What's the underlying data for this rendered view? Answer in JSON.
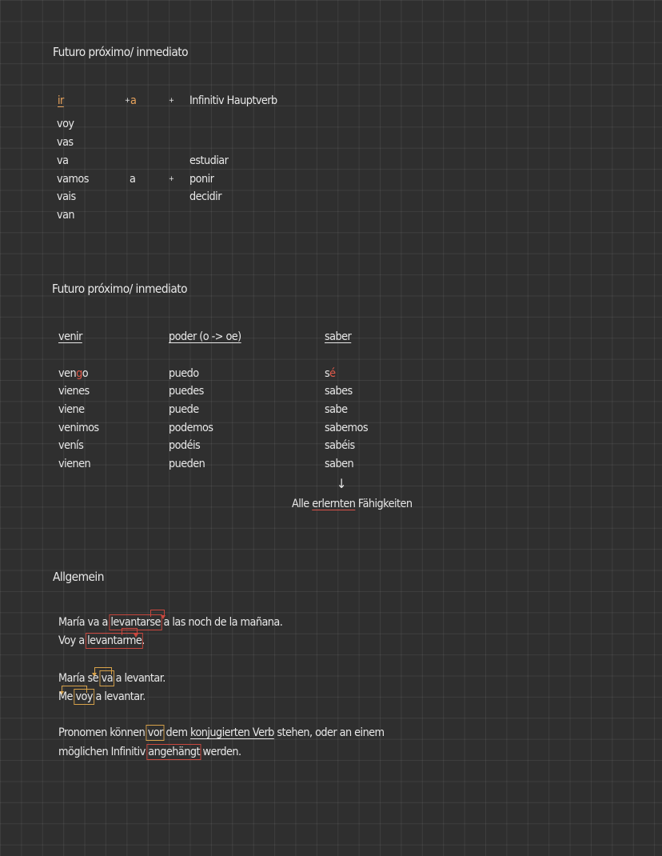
{
  "section1": {
    "title": "Futuro próximo/ inmediato",
    "header_ir": "ir",
    "header_plus1": "+",
    "header_a": "a",
    "header_plus2": "+",
    "header_infinitive": "Infinitiv Hauptverb",
    "ir_forms": [
      "voy",
      "vas",
      "va",
      "vamos",
      "vais",
      "van"
    ],
    "mid_a": "a",
    "mid_plus": "+",
    "examples": [
      "estudiar",
      "ponir",
      "decidir"
    ]
  },
  "section2": {
    "title": "Futuro próximo/ inmediato",
    "col1_header": "venir",
    "col2_header": "poder (o -> oe)",
    "col3_header": "saber",
    "venir_first": {
      "pre": "ven",
      "hl": "g",
      "post": "o"
    },
    "venir_rest": [
      "vienes",
      "viene",
      "venimos",
      "venís",
      "vienen"
    ],
    "poder": [
      "puedo",
      "puedes",
      "puede",
      "podemos",
      "podéis",
      "pueden"
    ],
    "saber_first": {
      "pre": "s",
      "hl": "é"
    },
    "saber_rest": [
      "sabes",
      "sabe",
      "sabemos",
      "sabéis",
      "saben"
    ],
    "arrow": "↓",
    "note": {
      "pre": "Alle ",
      "ul": "erlernten",
      "post": " Fähigkeiten"
    }
  },
  "section3": {
    "title": "Allgemein",
    "line1": {
      "pre": "María va a ",
      "box": "levantarse",
      "post": " a las noch de la mañana."
    },
    "line2": {
      "pre": "Voy a ",
      "box": "levantarme",
      "post": "."
    },
    "line3": {
      "pre": "María se ",
      "box": "va",
      "post": " a levantar."
    },
    "line4": {
      "pre": "Me ",
      "box": "voy",
      "post": " a levantar."
    },
    "line5": {
      "pre": "Pronomen können ",
      "box": "vor",
      "mid": " dem ",
      "ul": "konjugierten Verb",
      "post": " stehen, oder an einem"
    },
    "line6": {
      "pre": "möglichen Infinitiv ",
      "box": "angehängt",
      "post": " werden."
    }
  }
}
